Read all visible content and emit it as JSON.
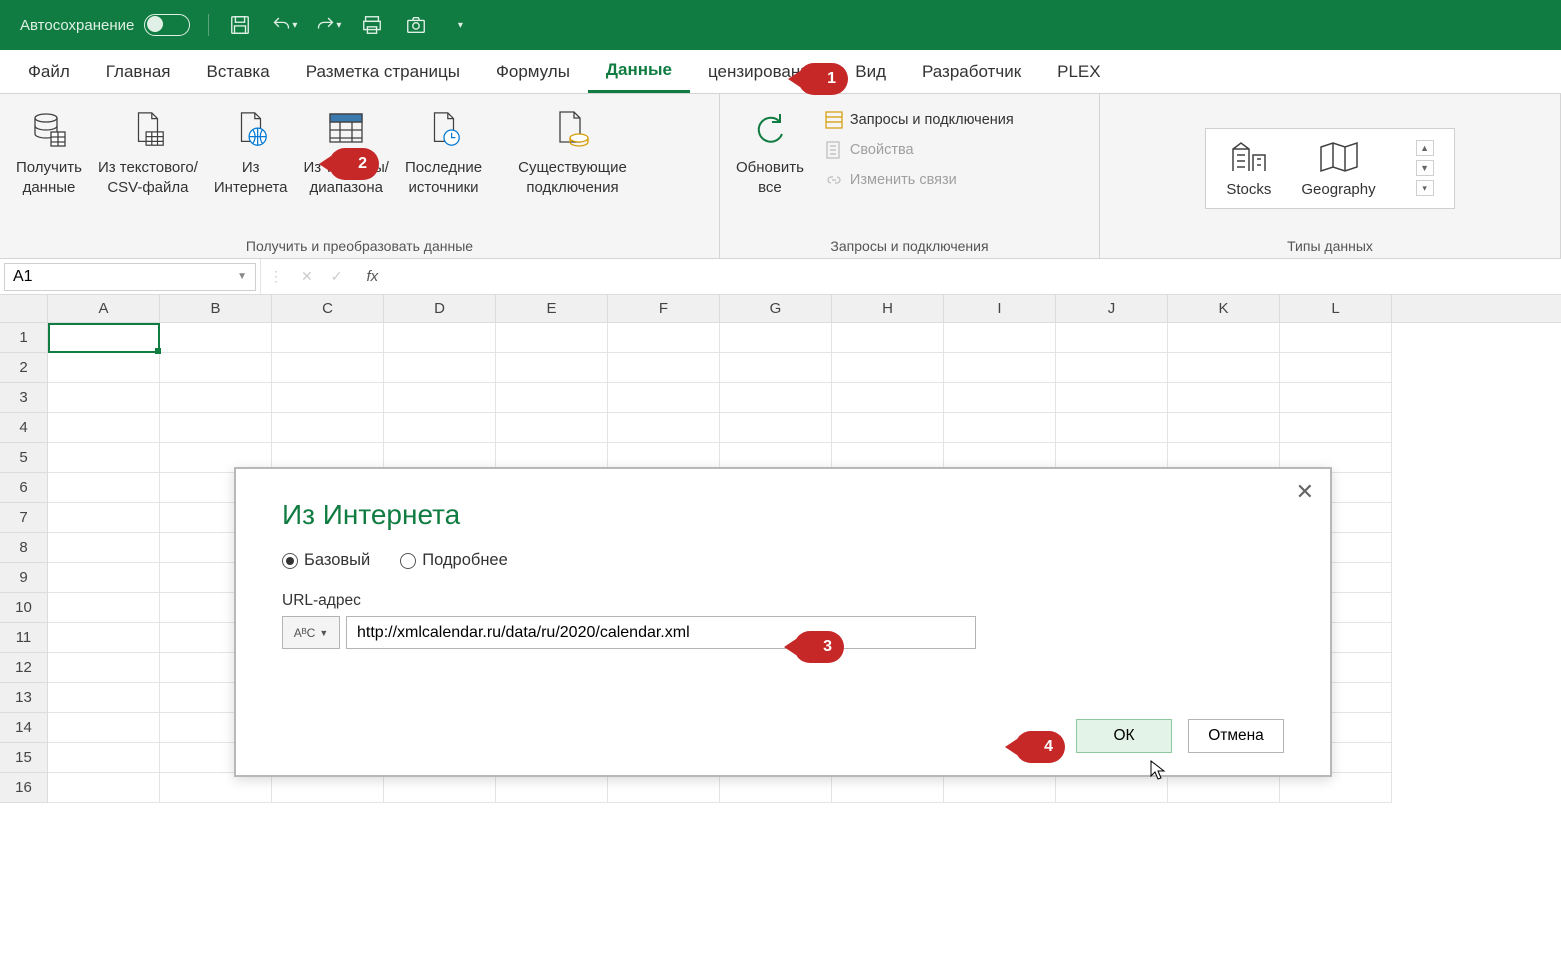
{
  "titlebar": {
    "autosave": "Автосохранение"
  },
  "tabs": [
    "Файл",
    "Главная",
    "Вставка",
    "Разметка страницы",
    "Формулы",
    "Данные",
    "цензирование",
    "Вид",
    "Разработчик",
    "PLEX"
  ],
  "active_tab": "Данные",
  "ribbon": {
    "group1": {
      "label": "Получить и преобразовать данные",
      "btn_get": "Получить\nданные",
      "btn_csv": "Из текстового/\nCSV-файла",
      "btn_web": "Из\nИнтернета",
      "btn_table": "Из таблицы/\nдиапазона",
      "btn_recent": "Последние\nисточники",
      "btn_conn": "Существующие\nподключения"
    },
    "group2": {
      "label": "Запросы и подключения",
      "btn_refresh": "Обновить\nвсе",
      "item_queries": "Запросы и подключения",
      "item_props": "Свойства",
      "item_links": "Изменить связи"
    },
    "group3": {
      "label": "Типы данных",
      "stocks": "Stocks",
      "geo": "Geography"
    }
  },
  "namebox": "A1",
  "columns": [
    "A",
    "B",
    "C",
    "D",
    "E",
    "F",
    "G",
    "H",
    "I",
    "J",
    "K",
    "L"
  ],
  "row_count": 16,
  "dialog": {
    "title": "Из Интернета",
    "radio_basic": "Базовый",
    "radio_advanced": "Подробнее",
    "url_label": "URL-адрес",
    "abc": "AᴮC",
    "url": "http://xmlcalendar.ru/data/ru/2020/calendar.xml",
    "ok": "ОК",
    "cancel": "Отмена"
  },
  "callouts": {
    "c1": "1",
    "c2": "2",
    "c3": "3",
    "c4": "4"
  }
}
